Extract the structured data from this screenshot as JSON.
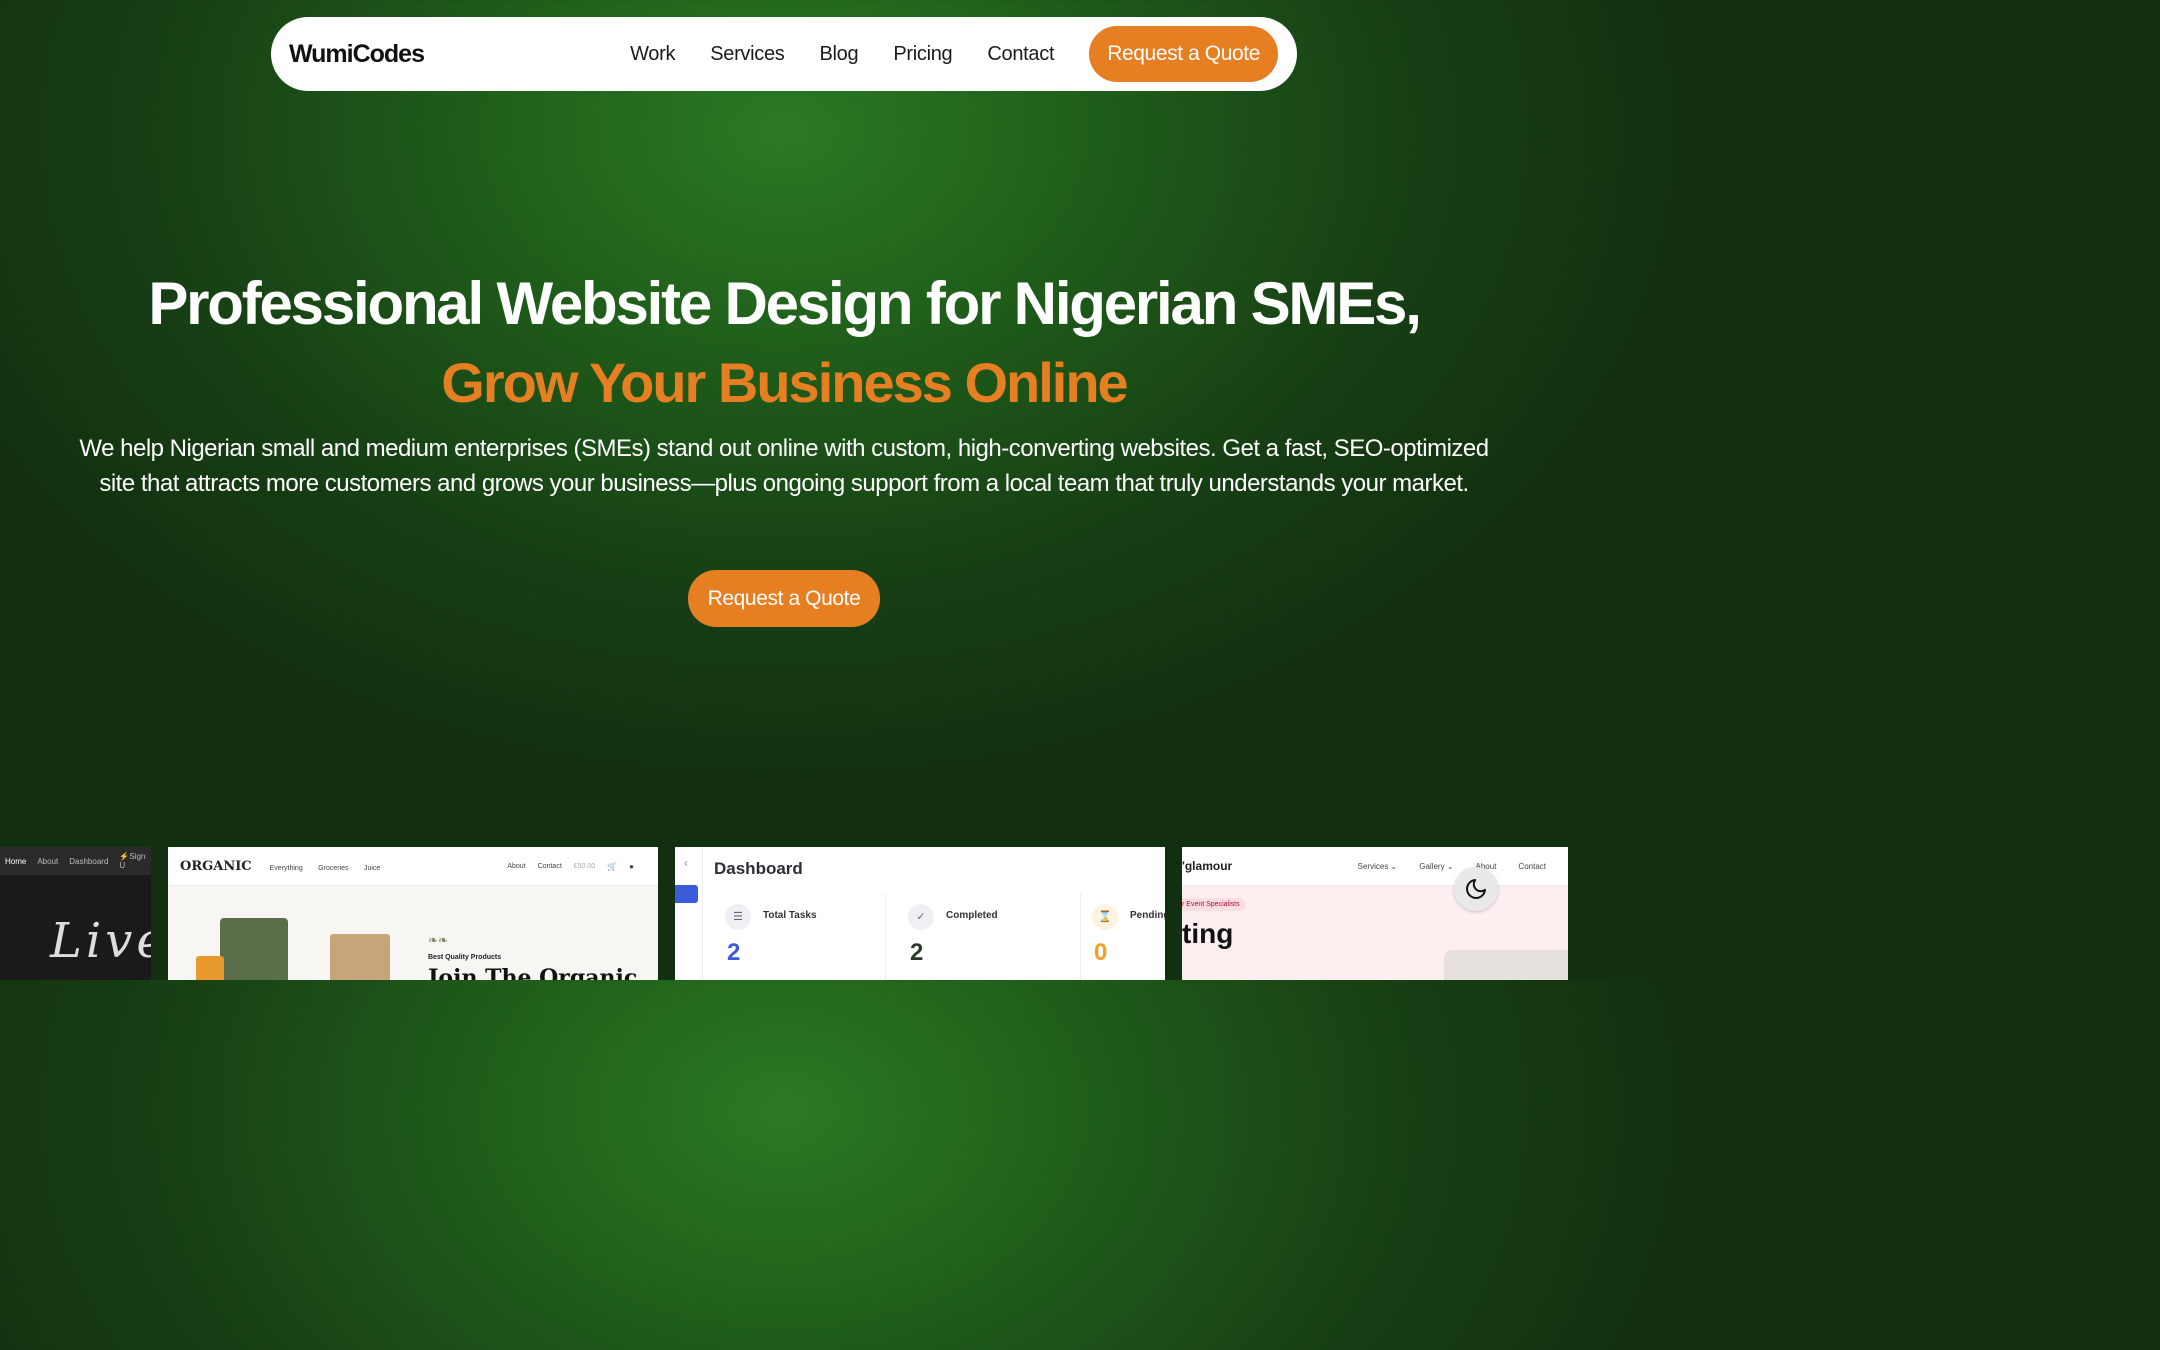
{
  "nav": {
    "logo": "WumiCodes",
    "links": [
      "Work",
      "Services",
      "Blog",
      "Pricing",
      "Contact"
    ],
    "cta": "Request a Quote"
  },
  "hero": {
    "title": "Professional Website Design for Nigerian SMEs,",
    "subtitle": "Grow Your Business Online",
    "description": "We help Nigerian small and medium enterprises (SMEs) stand out online with custom, high-converting websites. Get a fast, SEO-optimized site that attracts more customers and grows your business—plus ongoing support from a local team that truly understands your market.",
    "cta": "Request a Quote"
  },
  "colors": {
    "accent": "#e67e22",
    "background": "#1f5d1a"
  },
  "portfolio": {
    "card1": {
      "nav": [
        "Home",
        "About",
        "Dashboard",
        "⚡Sign U"
      ],
      "script": "Live"
    },
    "card2": {
      "logo": "ORGANIC",
      "menu": [
        "Everything",
        "Groceries",
        "Juice"
      ],
      "right": [
        "About",
        "Contact",
        "£50.00"
      ],
      "tag": "Best Quality Products",
      "headline": "Join The Organic"
    },
    "card3": {
      "title": "Dashboard",
      "stats": [
        {
          "label": "Total Tasks",
          "value": "2",
          "color": "#3b5bdb",
          "icon": "list-icon"
        },
        {
          "label": "Completed",
          "value": "2",
          "color": "#2a3a2a",
          "icon": "check-circle-icon"
        },
        {
          "label": "Pending",
          "value": "0",
          "color": "#f0a020",
          "icon": "hourglass-icon"
        }
      ]
    },
    "card4": {
      "logo": "'glamour",
      "menu": [
        "Services ⌄",
        "Gallery ⌄",
        "About",
        "Contact"
      ],
      "tag": "r Event Specialists",
      "headline": "ting"
    }
  },
  "theme_toggle": {
    "icon": "moon-icon"
  }
}
